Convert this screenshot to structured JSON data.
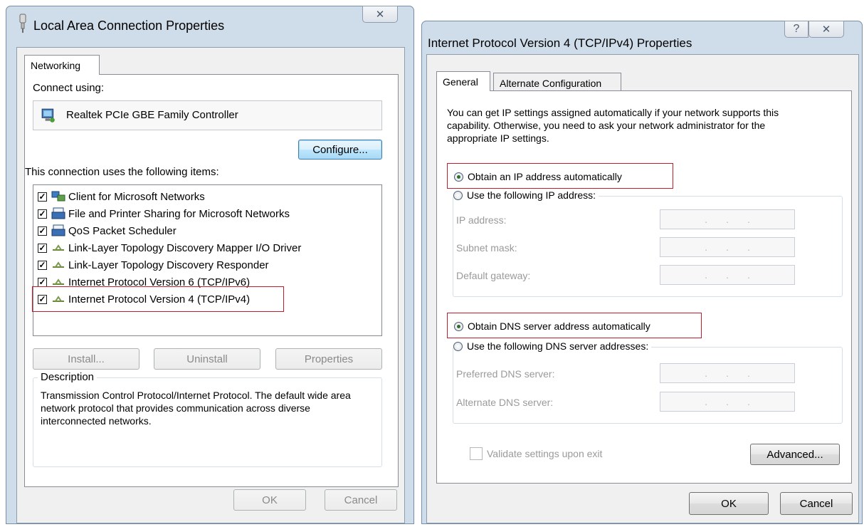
{
  "lan_window": {
    "title": "Local Area Connection Properties",
    "tab": "Networking",
    "connect_using_label": "Connect using:",
    "adapter_name": "Realtek PCIe GBE Family Controller",
    "configure_label": "Configure...",
    "items_label": "This connection uses the following items:",
    "items": [
      {
        "label": "Client for Microsoft Networks",
        "checked": true,
        "icon": "network-client-icon"
      },
      {
        "label": "File and Printer Sharing for Microsoft Networks",
        "checked": true,
        "icon": "printer-sharing-icon"
      },
      {
        "label": "QoS Packet Scheduler",
        "checked": true,
        "icon": "qos-icon"
      },
      {
        "label": "Link-Layer Topology Discovery Mapper I/O Driver",
        "checked": true,
        "icon": "protocol-icon"
      },
      {
        "label": "Link-Layer Topology Discovery Responder",
        "checked": true,
        "icon": "protocol-icon"
      },
      {
        "label": "Internet Protocol Version 6 (TCP/IPv6)",
        "checked": true,
        "icon": "protocol-icon"
      },
      {
        "label": "Internet Protocol Version 4 (TCP/IPv4)",
        "checked": true,
        "icon": "protocol-icon"
      }
    ],
    "install_label": "Install...",
    "uninstall_label": "Uninstall",
    "properties_label": "Properties",
    "description_legend": "Description",
    "description_text": "Transmission Control Protocol/Internet Protocol. The default wide area network protocol that provides communication across diverse interconnected networks.",
    "ok_label": "OK",
    "cancel_label": "Cancel",
    "close_glyph": "✕"
  },
  "ipv4_window": {
    "title": "Internet Protocol Version 4 (TCP/IPv4) Properties",
    "help_glyph": "?",
    "close_glyph": "✕",
    "tabs": [
      "General",
      "Alternate Configuration"
    ],
    "intro_text": "You can get IP settings assigned automatically if your network supports this capability. Otherwise, you need to ask your network administrator for the appropriate IP settings.",
    "obtain_ip_auto": "Obtain an IP address automatically",
    "use_following_ip": "Use the following IP address:",
    "ip_address_label": "IP address:",
    "subnet_mask_label": "Subnet mask:",
    "default_gateway_label": "Default gateway:",
    "obtain_dns_auto": "Obtain DNS server address automatically",
    "use_following_dns": "Use the following DNS server addresses:",
    "preferred_dns_label": "Preferred DNS server:",
    "alternate_dns_label": "Alternate DNS server:",
    "ip_dots": ".",
    "validate_label": "Validate settings upon exit",
    "advanced_label": "Advanced...",
    "ok_label": "OK",
    "cancel_label": "Cancel",
    "ip_mode": "automatic",
    "dns_mode": "automatic"
  },
  "colors": {
    "highlight_box": "#c41e2c",
    "frame": "#cfdcea"
  }
}
